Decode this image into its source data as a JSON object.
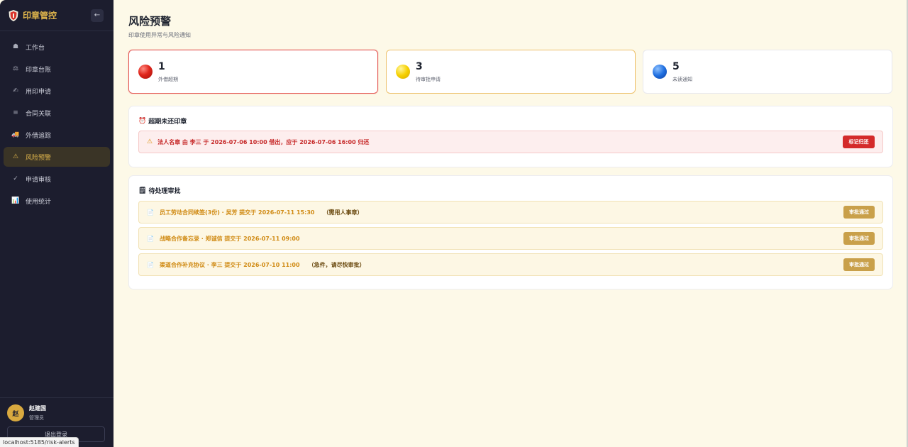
{
  "sidebar": {
    "brand": "印章管控",
    "collapse_icon": "←",
    "items": [
      {
        "label": "工作台",
        "icon": "☗"
      },
      {
        "label": "印章台账",
        "icon": "⚖"
      },
      {
        "label": "用印申请",
        "icon": "✍"
      },
      {
        "label": "合同关联",
        "icon": "≡"
      },
      {
        "label": "外借追踪",
        "icon": "🚚"
      },
      {
        "label": "风险预警",
        "icon": "⚠"
      },
      {
        "label": "申请审核",
        "icon": "✓"
      },
      {
        "label": "使用统计",
        "icon": "📊"
      }
    ],
    "active_index": 5,
    "user": {
      "avatar": "赵",
      "name": "赵建国",
      "role": "管理员"
    },
    "logout": "退出登录"
  },
  "status_url": "localhost:5185/risk-alerts",
  "main": {
    "title": "风险预警",
    "subtitle": "印章使用异常与风险通知",
    "stats": [
      {
        "value": "1",
        "label": "外借超期",
        "color": "red"
      },
      {
        "value": "3",
        "label": "待审批申请",
        "color": "yellow"
      },
      {
        "value": "5",
        "label": "未读通知",
        "color": "blue"
      }
    ],
    "overdue": {
      "icon": "⏰",
      "title": "超期未还印章",
      "items": [
        {
          "text": "法人名章 由 李三 于 2026-07-06 10:00 借出，应于 2026-07-06 16:00 归还",
          "action": "标记归还"
        }
      ]
    },
    "pending": {
      "icon": "🗒",
      "title": "待处理审批",
      "items": [
        {
          "text": "员工劳动合同续签(3份) · 吴芳 提交于 2026-07-11 15:30",
          "note": "（需用人事章）",
          "action": "审批通过"
        },
        {
          "text": "战略合作备忘录 · 郑诚信 提交于 2026-07-11 09:00",
          "note": "",
          "action": "审批通过"
        },
        {
          "text": "渠道合作补充协议 · 李三 提交于 2026-07-10 11:00",
          "note": "（急件，请尽快审批）",
          "action": "审批通过"
        }
      ]
    }
  },
  "colors": {
    "sidebar_bg": "#1c1d2e",
    "accent_gold": "#e0b64c",
    "page_bg": "#fdf9e8",
    "danger": "#d42a2a",
    "approve": "#c9a04a"
  }
}
